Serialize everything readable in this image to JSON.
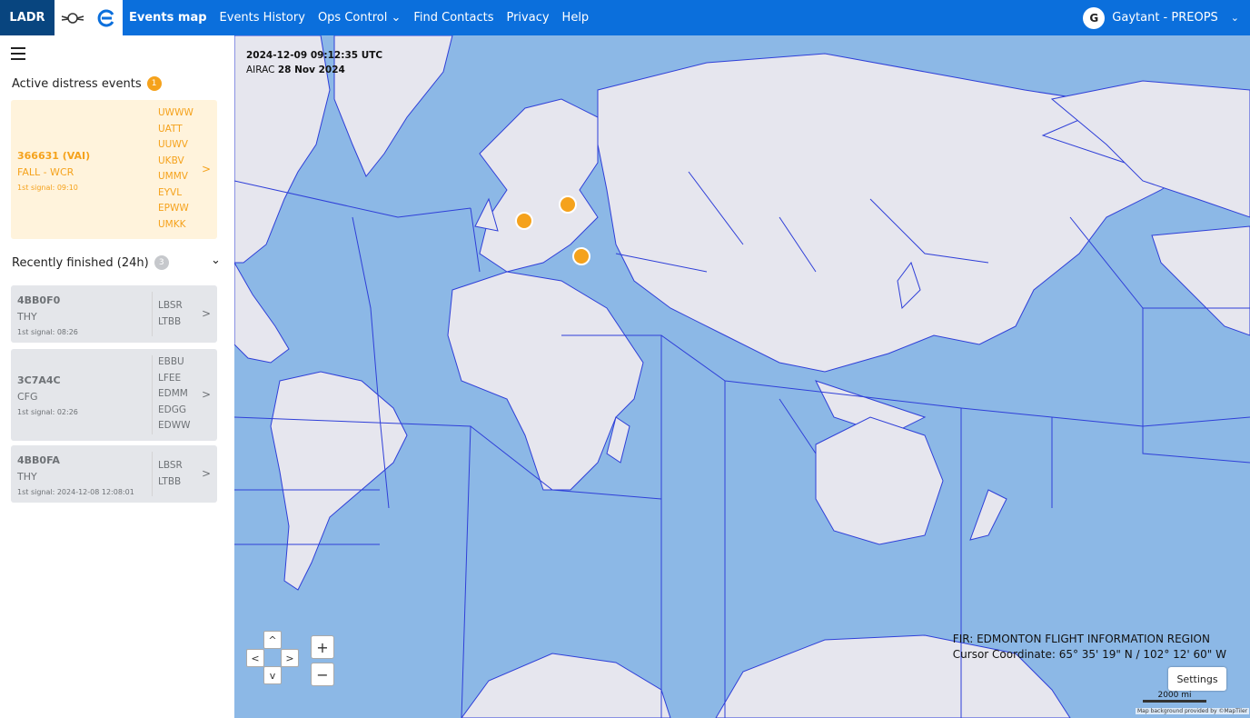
{
  "header": {
    "logo": "LADR",
    "nav": [
      {
        "label": "Events map",
        "active": true
      },
      {
        "label": "Events History"
      },
      {
        "label": "Ops Control ⌄"
      },
      {
        "label": "Find Contacts"
      },
      {
        "label": "Privacy"
      },
      {
        "label": "Help"
      }
    ],
    "user_initial": "G",
    "user_name": "Gaytant - PREOPS"
  },
  "sidebar": {
    "active_title": "Active distress events",
    "active_count": "1",
    "active_event": {
      "id": "366631 (VAI)",
      "type": "FALL - WCR",
      "signal": "1st signal: 09:10",
      "firs": [
        "UWWW",
        "UATT",
        "UUWV",
        "UKBV",
        "UMMV",
        "EYVL",
        "EPWW",
        "UMKK"
      ]
    },
    "finished_title": "Recently finished (24h)",
    "finished_count": "3",
    "finished": [
      {
        "id": "4BB0F0",
        "op": "THY",
        "signal": "1st signal: 08:26",
        "firs": [
          "LBSR",
          "LTBB"
        ]
      },
      {
        "id": "3C7A4C",
        "op": "CFG",
        "signal": "1st signal: 02:26",
        "firs": [
          "EBBU",
          "LFEE",
          "EDMM",
          "EDGG",
          "EDWW"
        ]
      },
      {
        "id": "4BB0FA",
        "op": "THY",
        "signal": "1st signal: 2024-12-08 12:08:01",
        "firs": [
          "LBSR",
          "LTBB"
        ]
      }
    ]
  },
  "map": {
    "timestamp": "2024-12-09 09:12:35 UTC",
    "airac_label": "AIRAC",
    "airac_date": "28 Nov 2024",
    "fir_info": "FIR: EDMONTON FLIGHT INFORMATION REGION",
    "cursor": "Cursor Coordinate: 65° 35' 19\" N / 102° 12' 60\" W",
    "settings_label": "Settings",
    "scale_label": "2000 mi",
    "attribution": "Map background provided by ©MapTiler",
    "controls": {
      "up": "^",
      "down": "v",
      "left": "<",
      "right": ">",
      "zoom_in": "+",
      "zoom_out": "−"
    }
  },
  "colors": {
    "ocean": "#8cb8e6",
    "land": "#e6e6ee",
    "fir_line": "#2f3fd8",
    "accent": "#f5a21c",
    "topbar": "#0b6fdc"
  }
}
